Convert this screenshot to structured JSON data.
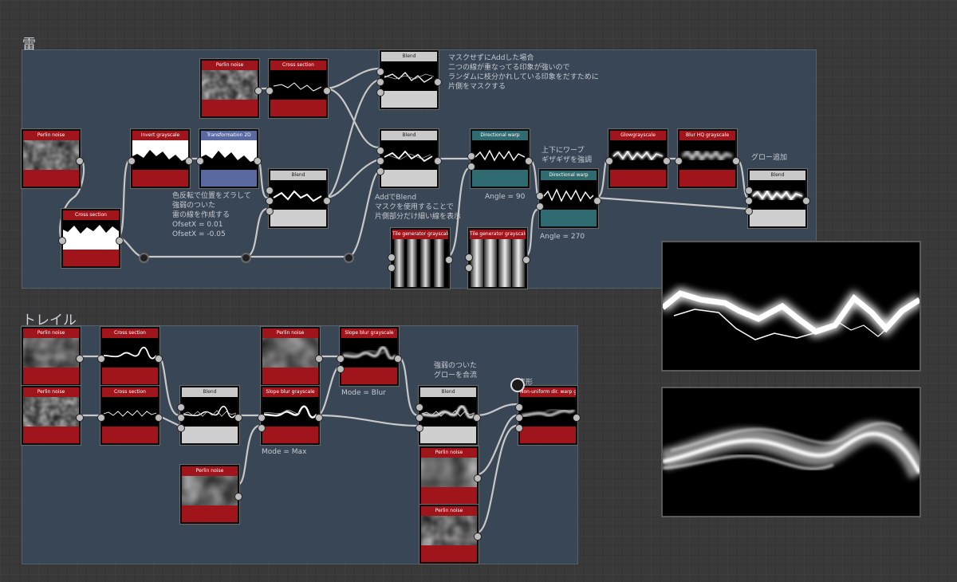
{
  "frames": {
    "kaminari_title": "雷",
    "trail_title": "トレイル"
  },
  "nodes": {
    "perlin_noise": "Perlin noise",
    "cross_section": "Cross section",
    "invert_grayscale": "Invert grayscale",
    "transformation_2d": "Transformation 2D",
    "blend": "Blend",
    "directional_warp": "Directional warp",
    "tile_generator_grayscale": "Tile generator grayscale",
    "glow_grayscale": "Glowgrayscale",
    "blur_hq_grayscale": "Blur HQ grayscale",
    "slope_blur_grayscale": "Slope blur grayscale",
    "non_uniform_dir_warp": "Non-uniform dir. warp gr..."
  },
  "comments": {
    "mask_note": [
      "マスクせずにAddした場合",
      "二つの線が重なってる印象が強いので",
      "ランダムに枝分かれしている印象をだすために",
      "片側をマスクする"
    ],
    "invert_note": [
      "色反転で位置をズラして",
      "強弱のついた",
      "雷の線を作成する",
      "OfsetX = 0.01",
      "OfsetX = -0.05"
    ],
    "add_blend_note": [
      "AddでBlend",
      "マスクを使用することで",
      "片側部分だけ細い線を表示"
    ],
    "warp_note": [
      "上下にワープ",
      "ギザギザを強調"
    ],
    "angle_90": "Angle = 90",
    "angle_270": "Angle = 270",
    "glow_note": "グロー追加",
    "mode_blur": "Mode = Blur",
    "mode_max": "Mode = Max",
    "glow_merge_note": [
      "強弱のついた",
      "グローを合流"
    ],
    "deform_note": "変形"
  },
  "colors": {
    "node_red": "#a0151b",
    "node_gray": "#c9c9c9",
    "node_blue": "#5a6aa0",
    "node_teal": "#2f6b70",
    "frame_bg": "#3a4858"
  },
  "icons": {
    "pin": "pin-icon"
  }
}
